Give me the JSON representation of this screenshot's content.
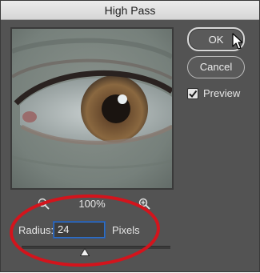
{
  "window": {
    "title": "High Pass"
  },
  "buttons": {
    "ok_label": "OK",
    "cancel_label": "Cancel"
  },
  "options": {
    "preview_label": "Preview",
    "preview_checked": true
  },
  "zoom": {
    "level": "100%"
  },
  "radius": {
    "label": "Radius:",
    "value": "24",
    "units": "Pixels",
    "slider_fraction": 0.4
  },
  "colors": {
    "dialog_bg": "#535353",
    "field_focus": "#2f6fc6",
    "highlight_ellipse": "#d3141c"
  },
  "icons": [
    "zoom-out-icon",
    "zoom-in-icon",
    "checkmark-icon",
    "cursor-icon",
    "slider-thumb-icon"
  ]
}
